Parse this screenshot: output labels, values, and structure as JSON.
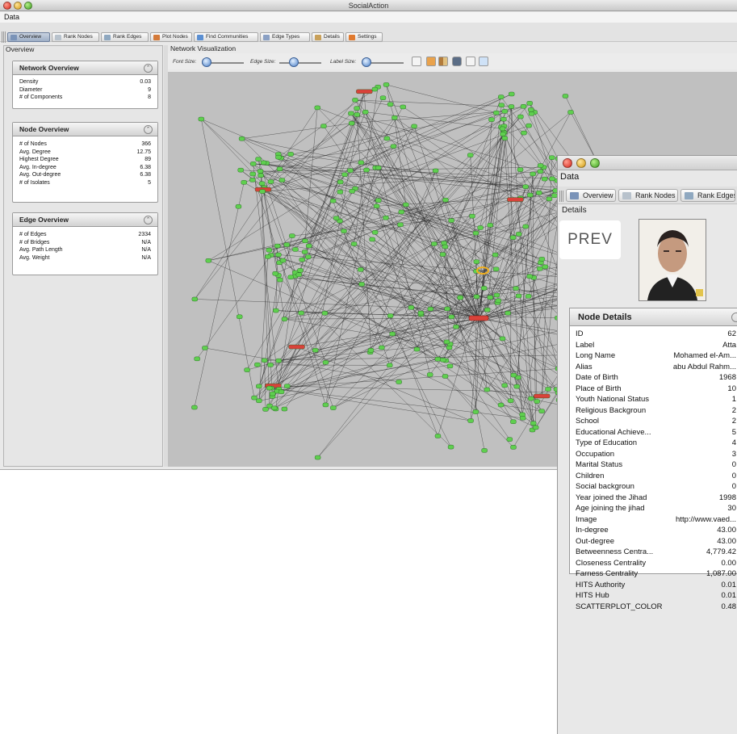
{
  "main_window": {
    "title": "SocialAction",
    "menu": "Data",
    "toolbar": [
      {
        "label": "Overview",
        "icon": "overview-icon",
        "active": true
      },
      {
        "label": "Rank Nodes",
        "icon": "rank-nodes-icon"
      },
      {
        "label": "Rank Edges",
        "icon": "rank-edges-icon"
      },
      {
        "label": "Plot Nodes",
        "icon": "plot-nodes-icon"
      },
      {
        "label": "Find Communities",
        "icon": "find-communities-icon"
      },
      {
        "label": "Edge Types",
        "icon": "edge-types-icon"
      },
      {
        "label": "Details",
        "icon": "details-icon"
      },
      {
        "label": "Settings",
        "icon": "settings-icon"
      }
    ]
  },
  "overview": {
    "section_label": "Overview",
    "network": {
      "title": "Network Overview",
      "rows": [
        {
          "k": "Density",
          "v": "0.03"
        },
        {
          "k": "Diameter",
          "v": "9"
        },
        {
          "k": "# of Components",
          "v": "8"
        }
      ]
    },
    "node": {
      "title": "Node Overview",
      "rows": [
        {
          "k": "# of Nodes",
          "v": "366"
        },
        {
          "k": "Avg. Degree",
          "v": "12.75"
        },
        {
          "k": "Highest Degree",
          "v": "89"
        },
        {
          "k": "Avg. In-degree",
          "v": "6.38"
        },
        {
          "k": "Avg. Out-degree",
          "v": "6.38"
        },
        {
          "k": "# of Isolates",
          "v": "5"
        }
      ]
    },
    "edge": {
      "title": "Edge Overview",
      "rows": [
        {
          "k": "# of Edges",
          "v": "2334"
        },
        {
          "k": "# of Bridges",
          "v": "N/A"
        },
        {
          "k": "Avg. Path Length",
          "v": "N/A"
        },
        {
          "k": "Avg. Weight",
          "v": "N/A"
        }
      ]
    }
  },
  "visualization": {
    "section_label": "Network Visualization",
    "font_size_label": "Font Size:",
    "edge_size_label": "Edge Size:",
    "label_size_label": "Label Size:",
    "colors": {
      "background": "#c0c0c0",
      "node": "#5fcf4f",
      "edge": "#222222",
      "highlight": "#d9423a"
    }
  },
  "details_window": {
    "menu": "Data",
    "toolbar": [
      {
        "label": "Overview",
        "icon": "overview-icon"
      },
      {
        "label": "Rank Nodes",
        "icon": "rank-nodes-icon"
      },
      {
        "label": "Rank Edges",
        "icon": "rank-edges-icon"
      }
    ],
    "section_label": "Details",
    "prev_label": "PREV",
    "node_details_title": "Node Details",
    "rows": [
      {
        "k": "ID",
        "v": "62"
      },
      {
        "k": "Label",
        "v": "Atta"
      },
      {
        "k": "Long Name",
        "v": "Mohamed el-Am..."
      },
      {
        "k": "Alias",
        "v": "abu Abdul Rahm..."
      },
      {
        "k": "Date of Birth",
        "v": "1968"
      },
      {
        "k": "Place of Birth",
        "v": "10"
      },
      {
        "k": "Youth National Status",
        "v": "1"
      },
      {
        "k": "Religious Backgroun",
        "v": "2"
      },
      {
        "k": "School",
        "v": "2"
      },
      {
        "k": "Educational Achieve...",
        "v": "5"
      },
      {
        "k": "Type of Education",
        "v": "4"
      },
      {
        "k": "Occupation",
        "v": "3"
      },
      {
        "k": "Marital Status",
        "v": "0"
      },
      {
        "k": "Children",
        "v": "0"
      },
      {
        "k": "Social backgroun",
        "v": "0"
      },
      {
        "k": "Year joined the Jihad",
        "v": "1998"
      },
      {
        "k": "Age joining the jihad",
        "v": "30"
      },
      {
        "k": "Image",
        "v": "http://www.vaed..."
      },
      {
        "k": "In-degree",
        "v": "43.00"
      },
      {
        "k": "Out-degree",
        "v": "43.00"
      },
      {
        "k": "Betweenness Centra...",
        "v": "4,779.42"
      },
      {
        "k": "Closeness Centrality",
        "v": "0.00"
      },
      {
        "k": "Farness Centrality",
        "v": "1,087.00"
      },
      {
        "k": "HITS Authority",
        "v": "0.01"
      },
      {
        "k": "HITS Hub",
        "v": "0.01"
      },
      {
        "k": "SCATTERPLOT_COLOR",
        "v": "0.48"
      }
    ]
  }
}
